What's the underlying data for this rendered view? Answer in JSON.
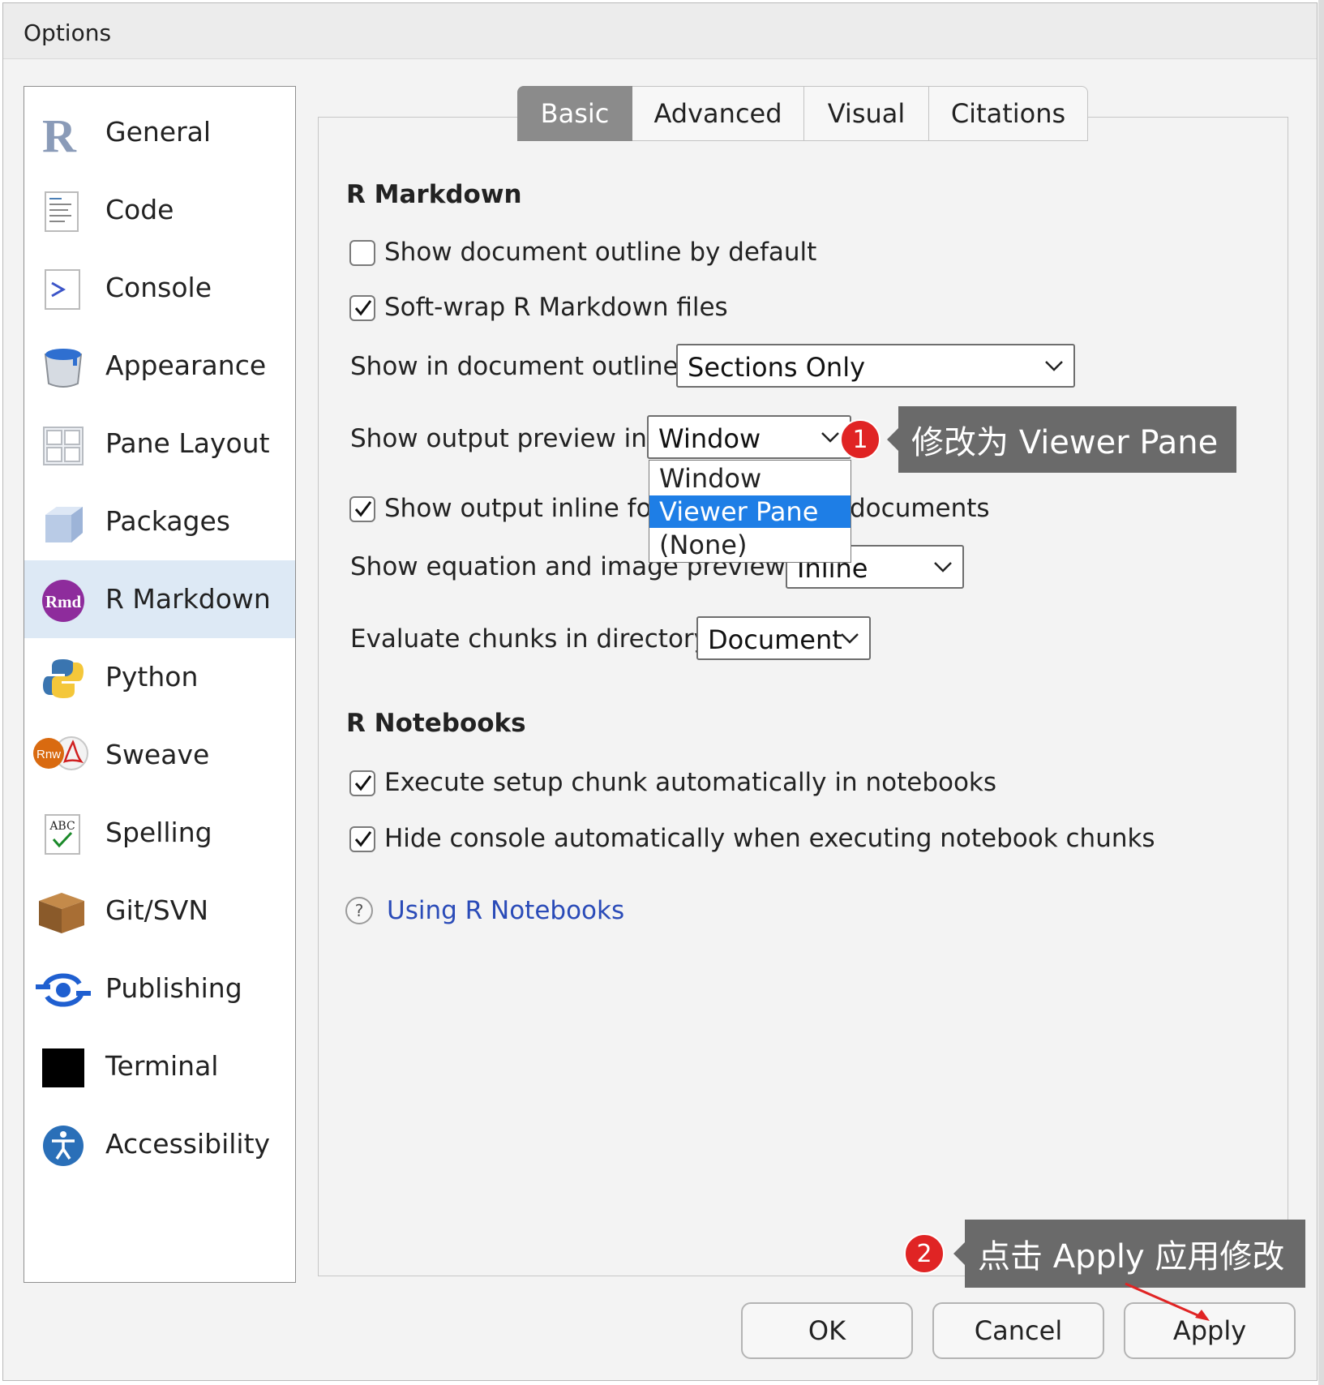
{
  "window": {
    "title": "Options"
  },
  "sidebar": {
    "items": [
      {
        "label": "General",
        "icon": "r-logo-icon"
      },
      {
        "label": "Code",
        "icon": "code-file-icon"
      },
      {
        "label": "Console",
        "icon": "console-prompt-icon"
      },
      {
        "label": "Appearance",
        "icon": "paint-bucket-icon"
      },
      {
        "label": "Pane Layout",
        "icon": "pane-grid-icon"
      },
      {
        "label": "Packages",
        "icon": "package-cube-icon"
      },
      {
        "label": "R Markdown",
        "icon": "rmd-icon",
        "active": true
      },
      {
        "label": "Python",
        "icon": "python-icon"
      },
      {
        "label": "Sweave",
        "icon": "sweave-pdf-icon"
      },
      {
        "label": "Spelling",
        "icon": "spelling-abc-icon"
      },
      {
        "label": "Git/SVN",
        "icon": "git-box-icon"
      },
      {
        "label": "Publishing",
        "icon": "publishing-icon"
      },
      {
        "label": "Terminal",
        "icon": "terminal-icon"
      },
      {
        "label": "Accessibility",
        "icon": "accessibility-icon"
      }
    ],
    "rmd_icon_text": "Rmd",
    "sweave_icon_text": "Rnw",
    "spelling_icon_text": "ABC"
  },
  "tabs": [
    "Basic",
    "Advanced",
    "Visual",
    "Citations"
  ],
  "active_tab": "Basic",
  "rmarkdown": {
    "section_title": "R Markdown",
    "show_outline_default": {
      "label": "Show document outline by default",
      "checked": false
    },
    "soft_wrap": {
      "label": "Soft-wrap R Markdown files",
      "checked": true
    },
    "show_in_outline": {
      "label": "Show in document outline:",
      "value": "Sections Only"
    },
    "output_preview": {
      "label": "Show output preview in:",
      "value": "Window",
      "options": [
        "Window",
        "Viewer Pane",
        "(None)"
      ],
      "highlighted": "Viewer Pane"
    },
    "show_output_inline": {
      "label_left": "Show output inline for",
      "label_right": "documents",
      "checked": true
    },
    "equation_previews": {
      "label": "Show equation and image previews:",
      "value": "Inline"
    },
    "evaluate_chunks": {
      "label": "Evaluate chunks in directory:",
      "value": "Document"
    }
  },
  "notebooks": {
    "section_title": "R Notebooks",
    "execute_setup": {
      "label": "Execute setup chunk automatically in notebooks",
      "checked": true
    },
    "hide_console": {
      "label": "Hide console automatically when executing notebook chunks",
      "checked": true
    },
    "help_link": "Using R Notebooks"
  },
  "buttons": {
    "ok": "OK",
    "cancel": "Cancel",
    "apply": "Apply"
  },
  "annotations": {
    "step1": {
      "badge": "1",
      "text": "修改为 Viewer Pane"
    },
    "step2": {
      "badge": "2",
      "text": "点击 Apply 应用修改"
    },
    "colors": {
      "badge": "#e02424",
      "callout": "#6a6a6a",
      "arrow": "#e02424",
      "highlight": "#1e7ee6",
      "link": "#2a4bb8"
    }
  }
}
